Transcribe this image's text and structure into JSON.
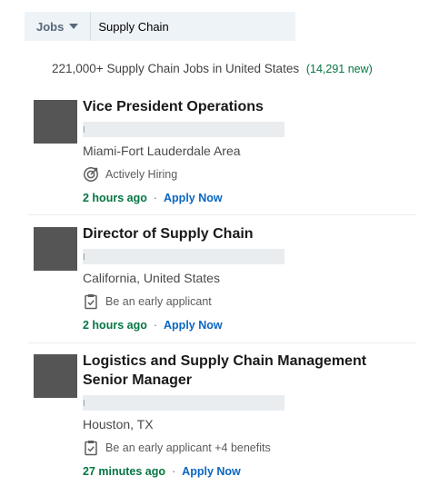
{
  "search": {
    "category_label": "Jobs",
    "query": "Supply Chain"
  },
  "summary": {
    "count_text": "221,000+",
    "description": "Supply Chain Jobs in United States",
    "new_text": "(14,291 new)"
  },
  "jobs": [
    {
      "title": "Vice President Operations",
      "location": "Miami-Fort Lauderdale Area",
      "insight_icon": "target-icon",
      "insight": "Actively Hiring",
      "posted": "2 hours ago",
      "apply_label": "Apply Now"
    },
    {
      "title": "Director of Supply Chain",
      "location": "California, United States",
      "insight_icon": "clipboard-check-icon",
      "insight": "Be an early applicant",
      "posted": "2 hours ago",
      "apply_label": "Apply Now"
    },
    {
      "title": "Logistics and Supply Chain Management Senior Manager",
      "location": "Houston, TX",
      "insight_icon": "clipboard-check-icon",
      "insight": "Be an early applicant +4 benefits",
      "posted": "27 minutes ago",
      "apply_label": "Apply Now"
    }
  ],
  "colors": {
    "accent_green": "#057642",
    "link_blue": "#0a66c2",
    "search_bg": "#eef3f8",
    "logo_placeholder": "#555555"
  }
}
